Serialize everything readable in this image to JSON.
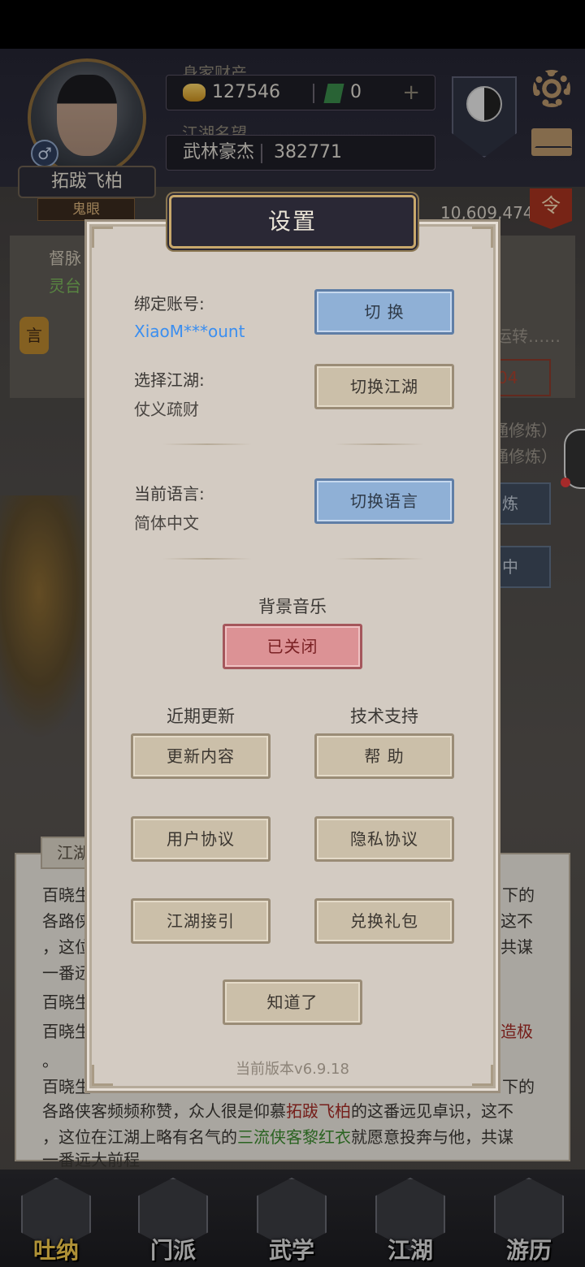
{
  "background": {
    "player": {
      "name": "拓跋飞柏",
      "title": "鬼眼",
      "gender_icon": "♂"
    },
    "wealth": {
      "label": "身家财产",
      "gold": "127546",
      "jade": "0"
    },
    "reputation": {
      "label": "江湖名望",
      "rank": "武林豪杰",
      "value": "382771"
    },
    "order_badge": "令",
    "power_value": "10,609,474",
    "lantern_char": "言",
    "side_texts": {
      "meridian_label": "督脉",
      "meridian_value": "灵台",
      "running": "运转……",
      "red_value": "04",
      "practice1": "通修炼）",
      "practice2": "通修炼）",
      "btn1": "炼",
      "btn2": "中"
    },
    "story": {
      "tab": "江湖",
      "line1_left": "百晓生",
      "line1_right": "下的",
      "line2_left": "各路侠",
      "line2_right": "这不",
      "line3_left": "，这位",
      "line3_right": "共谋",
      "line4_left": "一番远",
      "line5_left": "百晓生",
      "line6_left": "百晓生",
      "line6_right": "造极",
      "line7_left": "。",
      "line8_left": "百晓生",
      "line8_right": "下的",
      "line9_a": "各路侠客频频称赞，众人很是仰慕",
      "line9_b": "拓跋飞柏",
      "line9_c": "的这番远见卓识，这不",
      "line10_a": "，这位在江湖上略有名气的",
      "line10_b": "三流侠客黎红衣",
      "line10_c": "就愿意投奔与他，共谋",
      "line11_a": "一番远大前程"
    },
    "nav": [
      "吐纳",
      "门派",
      "武学",
      "江湖",
      "游历"
    ]
  },
  "dialog": {
    "title": "设置",
    "account_label": "绑定账号:",
    "account_value": "XiaoM***ount",
    "account_button": "切 换",
    "world_label": "选择江湖:",
    "world_value": "仗义疏财",
    "world_button": "切换江湖",
    "language_label": "当前语言:",
    "language_value": "简体中文",
    "language_button": "切换语言",
    "music_label": "背景音乐",
    "music_button": "已关闭",
    "updates_label": "近期更新",
    "support_label": "技术支持",
    "updates_button": "更新内容",
    "help_button": "帮 助",
    "user_agreement_button": "用户协议",
    "privacy_button": "隐私协议",
    "guide_button": "江湖接引",
    "redeem_button": "兑换礼包",
    "ok_button": "知道了",
    "version": "当前版本v6.9.18"
  },
  "colors": {
    "dialog_bg": "#d3cbc2",
    "blue_button": "#8fb0d6",
    "red_button": "#dc9295",
    "tan_button": "#cbbfa9",
    "link": "#3a8ef0"
  }
}
